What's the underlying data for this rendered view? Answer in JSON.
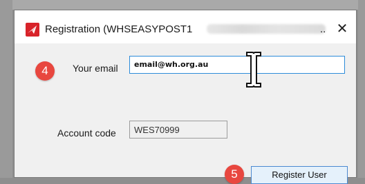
{
  "window": {
    "title": "Registration (WHSEASYPOST1",
    "title_suffix": "..",
    "close_glyph": "✕",
    "app_icon": "red-envelope-logo-icon"
  },
  "form": {
    "step4_number": "4",
    "email_label": "Your email",
    "email_value": "email@wh.org.au",
    "account_label": "Account code",
    "account_value": "WES70999",
    "step5_number": "5",
    "register_label": "Register User"
  },
  "colors": {
    "badge": "#e8473f",
    "input_focus_border": "#2c8bd9",
    "button_border": "#4a88d0",
    "button_bg": "#e5f1fb"
  },
  "cursor": "text-ibeam-cursor-icon"
}
